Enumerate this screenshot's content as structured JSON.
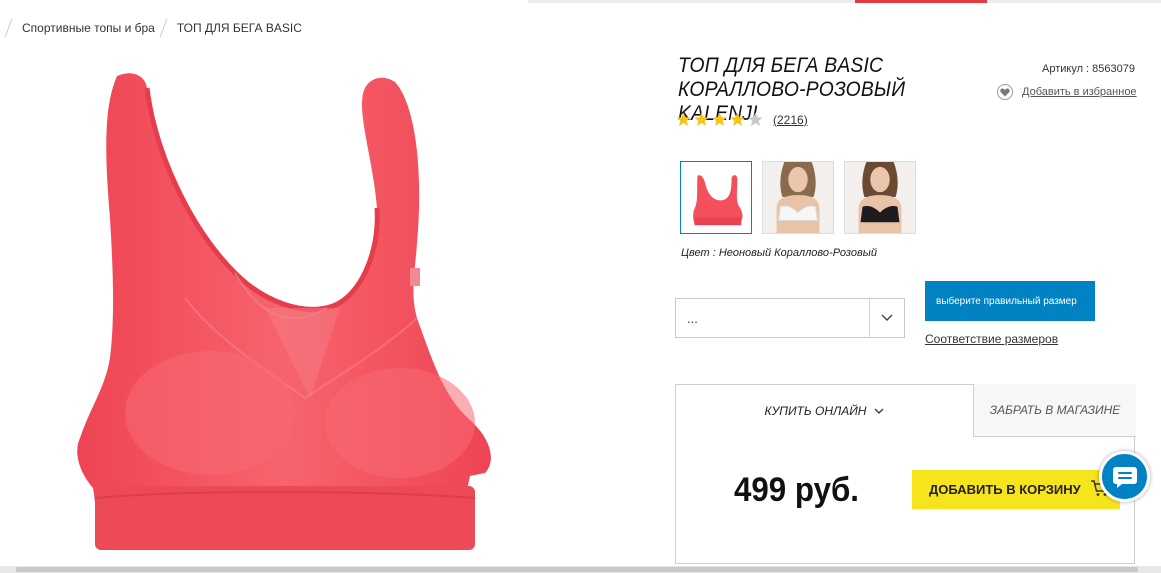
{
  "breadcrumb": {
    "items": [
      "Спортивные топы и бра",
      "ТОП ДЛЯ БЕГА BASIC"
    ]
  },
  "product": {
    "title_line1": "ТОП ДЛЯ БЕГА BASIC",
    "title_line2": "КОРАЛЛОВО-РОЗОВЫЙ KALENJI",
    "sku": "Артикул : 8563079",
    "favorite_label": "Добавить в избранное",
    "rating": 4,
    "rating_max": 5,
    "review_count": "(2216)",
    "color_label": "Цвет : Неоновый Кораллово-Розовый",
    "main_color": "#f4505c",
    "thumbnails": [
      {
        "name": "coral-top",
        "selected": true
      },
      {
        "name": "white-model",
        "selected": false
      },
      {
        "name": "black-model",
        "selected": false
      }
    ]
  },
  "size": {
    "select_value": "...",
    "choose_button": "выберите правильный размер",
    "guide_link": "Соответствие размеров"
  },
  "purchase": {
    "tab_online": "КУПИТЬ ОНЛАЙН",
    "tab_store": "ЗАБРАТЬ В МАГАЗИНЕ",
    "price": "499 руб.",
    "add_to_cart": "ДОБАВИТЬ В КОРЗИНУ"
  },
  "colors": {
    "accent_blue": "#0082c3",
    "cart_yellow": "#f6e41c",
    "star_yellow": "#f6c51c",
    "header_red": "#e0393e"
  },
  "icons": [
    "heart-icon",
    "star-icon",
    "chevron-down-icon",
    "cart-icon",
    "chat-icon"
  ]
}
